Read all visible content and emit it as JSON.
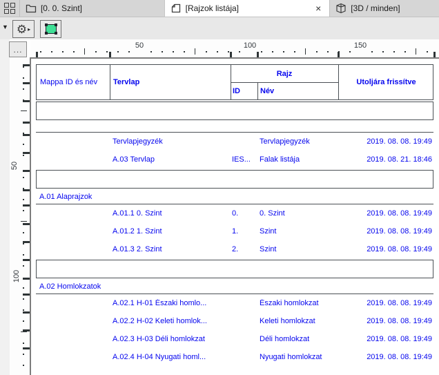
{
  "tabs": [
    {
      "label": "[0. 0. Szint]",
      "icon": "floor-plan-icon"
    },
    {
      "label": "[Rajzok listája]",
      "icon": "drawing-list-icon",
      "active": true
    },
    {
      "label": "[3D / minden]",
      "icon": "3d-view-icon"
    }
  ],
  "icons": {
    "caret_down": "▼",
    "gear": "⚙",
    "flyout_arrow": "▸",
    "close": "×",
    "overflow": "..."
  },
  "rulers": {
    "horizontal_labels": [
      "50",
      "100",
      "150"
    ],
    "vertical_labels": [
      "50",
      "100"
    ]
  },
  "table": {
    "headers": {
      "mappa": "Mappa ID és név",
      "tervlap": "Tervlap",
      "rajz": "Rajz",
      "id": "ID",
      "nev": "Név",
      "updated": "Utoljára frissítve"
    },
    "sections": [
      {
        "label": null,
        "drawings": [
          {
            "tervlap": "Tervlapjegyzék",
            "id": "",
            "nev": "Tervlapjegyzék",
            "updated": "2019. 08. 08. 19:49"
          },
          {
            "tervlap": "A.03 Tervlap",
            "id": "IES...",
            "nev": "Falak listája",
            "updated": "2019. 08. 21. 18:46"
          }
        ]
      },
      {
        "label": "A.01 Alaprajzok",
        "drawings": [
          {
            "tervlap": "A.01.1 0. Szint",
            "id": "0.",
            "nev": "0. Szint",
            "updated": "2019. 08. 08. 19:49"
          },
          {
            "tervlap": "A.01.2 1. Szint",
            "id": "1.",
            "nev": "Szint",
            "updated": "2019. 08. 08. 19:49"
          },
          {
            "tervlap": "A.01.3 2. Szint",
            "id": "2.",
            "nev": "Szint",
            "updated": "2019. 08. 08. 19:49"
          }
        ]
      },
      {
        "label": "A.02 Homlokzatok",
        "drawings": [
          {
            "tervlap": "A.02.1 H-01 Északi homlo...",
            "id": "",
            "nev": "Északi homlokzat",
            "updated": "2019. 08. 08. 19:49"
          },
          {
            "tervlap": "A.02.2 H-02 Keleti homlok...",
            "id": "",
            "nev": "Keleti homlokzat",
            "updated": "2019. 08. 08. 19:49"
          },
          {
            "tervlap": "A.02.3 H-03 Déli homlokzat",
            "id": "",
            "nev": "Déli homlokzat",
            "updated": "2019. 08. 08. 19:49"
          },
          {
            "tervlap": "A.02.4 H-04 Nyugati homl...",
            "id": "",
            "nev": "Nyugati homlokzat",
            "updated": "2019. 08. 08. 19:49"
          }
        ]
      }
    ]
  },
  "colors": {
    "drawing_text_blue": "#0505ee",
    "marquee_green": "#3fe096",
    "chrome_gray": "#d6d6d6"
  }
}
